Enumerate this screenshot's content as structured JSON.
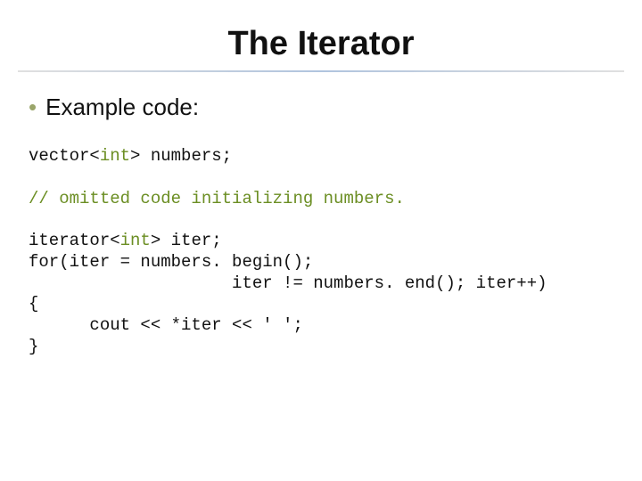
{
  "title": "The Iterator",
  "bullet": "Example code:",
  "code": {
    "l1a": "vector<",
    "l1b": "int",
    "l1c": "> numbers;",
    "l2": "// omitted code initializing numbers.",
    "l3a": "iterator<",
    "l3b": "int",
    "l3c": "> iter;",
    "l4": "for(iter = numbers. begin();",
    "l5": "                    iter != numbers. end(); iter++)",
    "l6": "{",
    "l7": "      cout << *iter << ' ';",
    "l8": "}"
  }
}
